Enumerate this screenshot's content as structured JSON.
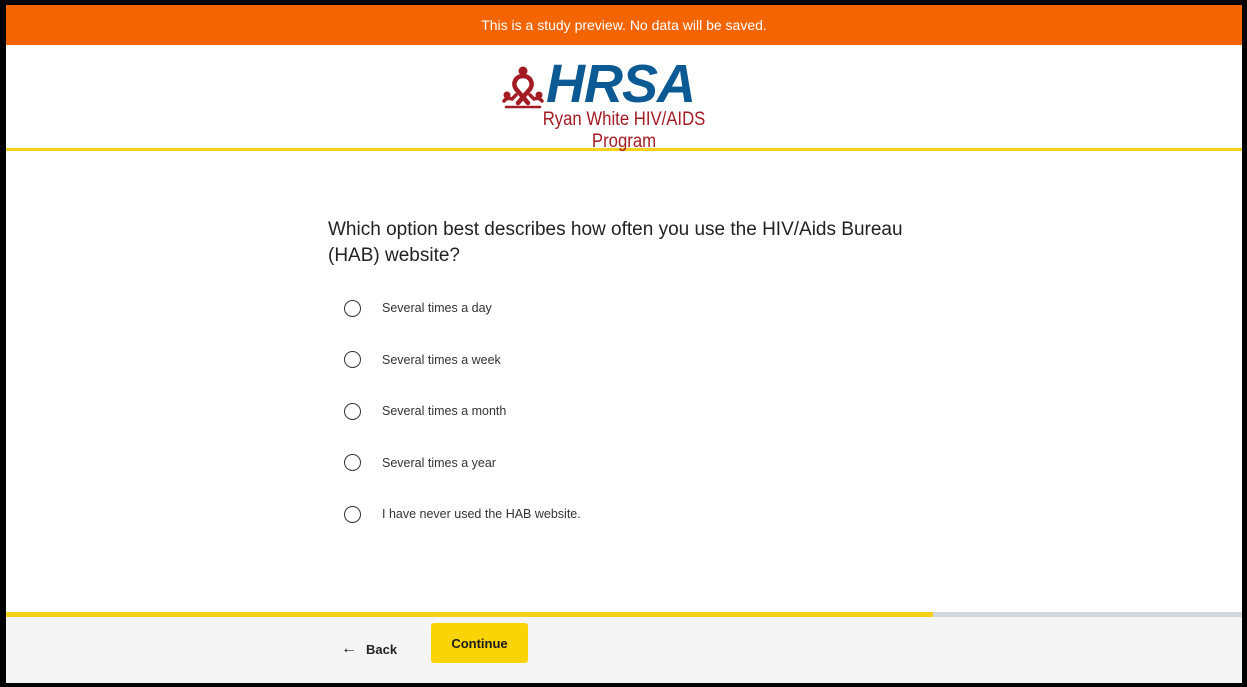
{
  "banner": {
    "text": "This is a study preview. No data will be saved.",
    "color": "#f46400"
  },
  "header": {
    "logo": {
      "wordmark": "HRSA",
      "subtitle": "Ryan White HIV/AIDS Program",
      "icon": "red-ribbon-people-icon",
      "wordmark_color": "#0b5a94",
      "subtitle_color": "#a31b23"
    },
    "accent_color": "#f7d01a"
  },
  "question": {
    "text": "Which option best describes how often you use the HIV/Aids Bureau (HAB) website?",
    "options": [
      {
        "label": "Several times a day",
        "selected": false
      },
      {
        "label": "Several times a week",
        "selected": false
      },
      {
        "label": "Several times a month",
        "selected": false
      },
      {
        "label": "Several times a year",
        "selected": false
      },
      {
        "label": "I have never used the HAB website.",
        "selected": false
      }
    ]
  },
  "progress": {
    "fraction": 0.75,
    "fill_color": "#f7d01a",
    "track_color": "#d3d8dd"
  },
  "footer": {
    "back_label": "Back",
    "back_icon": "arrow-left-icon",
    "continue_label": "Continue",
    "continue_color": "#fbd408"
  }
}
